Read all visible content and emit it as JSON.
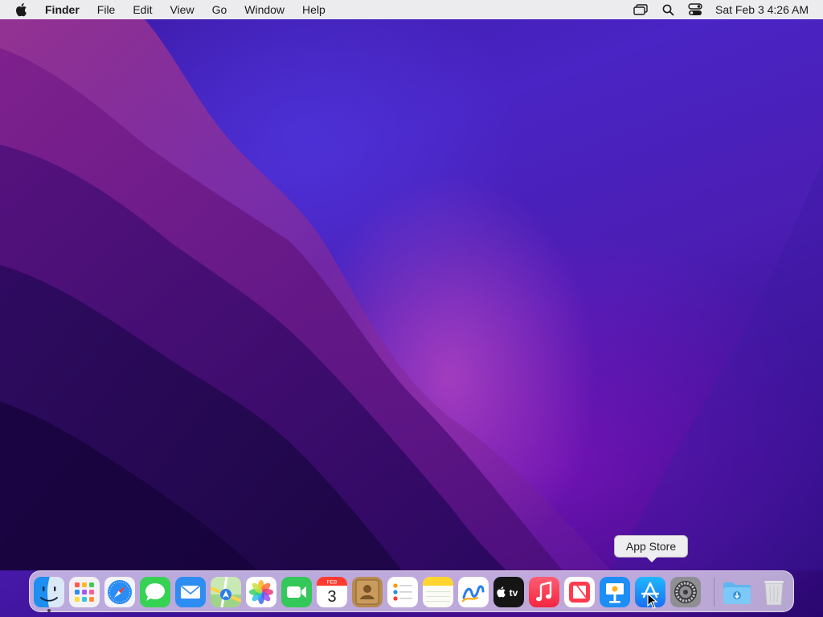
{
  "menubar": {
    "app_name": "Finder",
    "items": [
      "File",
      "Edit",
      "View",
      "Go",
      "Window",
      "Help"
    ],
    "status_icons": [
      "screen-mirroring-icon",
      "spotlight-search-icon",
      "control-center-icon"
    ],
    "clock": "Sat Feb 3  4:26 AM"
  },
  "dock": {
    "apps": [
      {
        "name": "finder",
        "running": true
      },
      {
        "name": "launchpad",
        "running": false
      },
      {
        "name": "safari",
        "running": false
      },
      {
        "name": "messages",
        "running": false
      },
      {
        "name": "mail",
        "running": false
      },
      {
        "name": "maps",
        "running": false
      },
      {
        "name": "photos",
        "running": false
      },
      {
        "name": "facetime",
        "running": false
      },
      {
        "name": "calendar",
        "running": false
      },
      {
        "name": "contacts",
        "running": false
      },
      {
        "name": "reminders",
        "running": false
      },
      {
        "name": "notes",
        "running": false
      },
      {
        "name": "freeform",
        "running": false
      },
      {
        "name": "apple-tv",
        "running": false
      },
      {
        "name": "music",
        "running": false
      },
      {
        "name": "news",
        "running": false
      },
      {
        "name": "keynote",
        "running": false
      },
      {
        "name": "app-store",
        "running": false
      },
      {
        "name": "system-settings",
        "running": false
      }
    ],
    "others": [
      "downloads-folder",
      "trash"
    ],
    "calendar": {
      "month": "FEB",
      "day": "3"
    },
    "tv_label": "tv"
  },
  "tooltip": {
    "text": "App Store"
  },
  "colors": {
    "menubar_bg": "#ecebee",
    "dock_bg": "#ece4f5",
    "wallpaper_accent": "#a11ab8"
  }
}
